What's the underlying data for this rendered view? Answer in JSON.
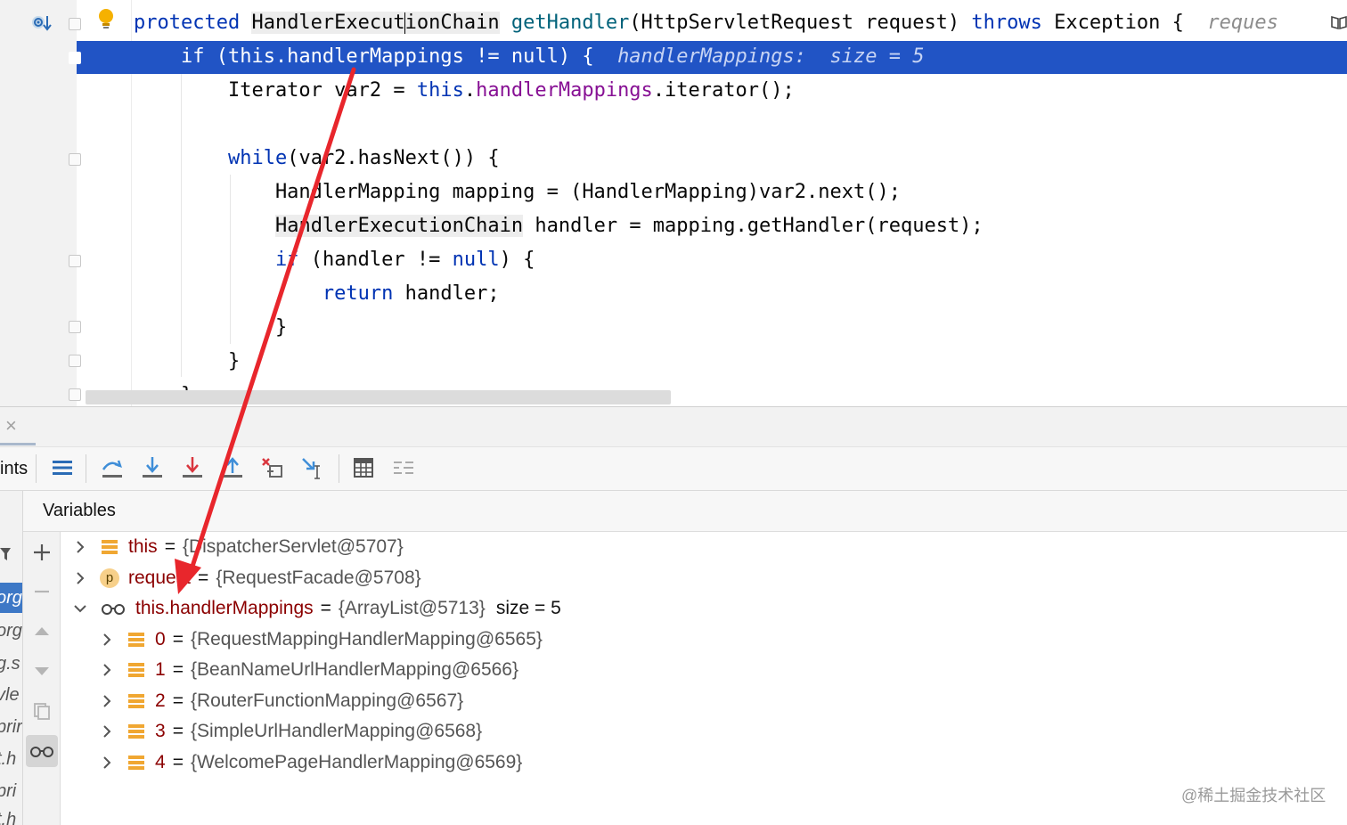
{
  "editor": {
    "lines": [
      {
        "parts": [
          [
            "kw",
            "protected "
          ],
          [
            "ident-box",
            "HandlerExecut"
          ],
          [
            "caret",
            ""
          ],
          [
            "ident-box",
            "ionChain"
          ],
          [
            "plain",
            " "
          ],
          [
            "fn",
            "getHandler"
          ],
          [
            "plain",
            "(HttpServletRequest request) "
          ],
          [
            "kw",
            "throws"
          ],
          [
            "plain",
            " Exception {  "
          ],
          [
            "hint",
            "reques"
          ]
        ]
      },
      {
        "parts": [
          [
            "highlight-text",
            "    if (this.handlerMappings != null) {  "
          ],
          [
            "highlight-hint",
            "handlerMappings:  size = 5"
          ]
        ]
      },
      {
        "parts": [
          [
            "plain",
            "        Iterator var2 = "
          ],
          [
            "kw",
            "this"
          ],
          [
            "plain",
            "."
          ],
          [
            "field",
            "handlerMappings"
          ],
          [
            "plain",
            ".iterator();"
          ]
        ]
      },
      {
        "parts": [
          [
            "plain",
            ""
          ]
        ]
      },
      {
        "parts": [
          [
            "plain",
            "        "
          ],
          [
            "kw",
            "while"
          ],
          [
            "plain",
            "(var2.hasNext()) {"
          ]
        ]
      },
      {
        "parts": [
          [
            "plain",
            "            HandlerMapping mapping = (HandlerMapping)var2.next();"
          ]
        ]
      },
      {
        "parts": [
          [
            "plain",
            "            "
          ],
          [
            "ident-box",
            "HandlerExecutionChain"
          ],
          [
            "plain",
            " handler = mapping.getHandler(request);"
          ]
        ]
      },
      {
        "parts": [
          [
            "plain",
            "            "
          ],
          [
            "kw",
            "if"
          ],
          [
            "plain",
            " (handler != "
          ],
          [
            "kw",
            "null"
          ],
          [
            "plain",
            ") {"
          ]
        ]
      },
      {
        "parts": [
          [
            "plain",
            "                "
          ],
          [
            "kw",
            "return"
          ],
          [
            "plain",
            " handler;"
          ]
        ]
      },
      {
        "parts": [
          [
            "plain",
            "            }"
          ]
        ]
      },
      {
        "parts": [
          [
            "plain",
            "        }"
          ]
        ]
      },
      {
        "parts": [
          [
            "plain",
            "    }"
          ]
        ]
      }
    ]
  },
  "debug": {
    "toolbar_label": "ints",
    "variables_title": "Variables",
    "frames": [
      "",
      "org",
      "org",
      "g.s",
      "vle",
      "prir",
      "t.h",
      "pri",
      "t.h"
    ],
    "variables": [
      {
        "level": 0,
        "expanded": false,
        "icon": "field-icon",
        "name": "this",
        "value": "{DispatcherServlet@5707}",
        "extra": ""
      },
      {
        "level": 0,
        "expanded": false,
        "icon": "parameter-icon",
        "name": "request",
        "value": "{RequestFacade@5708}",
        "extra": ""
      },
      {
        "level": 0,
        "expanded": true,
        "icon": "watch-glasses-icon",
        "name": "this.handlerMappings",
        "value": "{ArrayList@5713}",
        "extra": "size = 5"
      },
      {
        "level": 1,
        "expanded": false,
        "icon": "field-icon",
        "name": "0",
        "value": "{RequestMappingHandlerMapping@6565}",
        "extra": ""
      },
      {
        "level": 1,
        "expanded": false,
        "icon": "field-icon",
        "name": "1",
        "value": "{BeanNameUrlHandlerMapping@6566}",
        "extra": ""
      },
      {
        "level": 1,
        "expanded": false,
        "icon": "field-icon",
        "name": "2",
        "value": "{RouterFunctionMapping@6567}",
        "extra": ""
      },
      {
        "level": 1,
        "expanded": false,
        "icon": "field-icon",
        "name": "3",
        "value": "{SimpleUrlHandlerMapping@6568}",
        "extra": ""
      },
      {
        "level": 1,
        "expanded": false,
        "icon": "field-icon",
        "name": "4",
        "value": "{WelcomePageHandlerMapping@6569}",
        "extra": ""
      }
    ],
    "p_badge": "p",
    "close_glyph": "×"
  },
  "watermark": "@稀土掘金技术社区",
  "colors": {
    "highlight": "#2154c5",
    "arrow": "#e8262c",
    "keyword": "#0033b3",
    "field": "#871094",
    "var_name": "#8b0000"
  }
}
